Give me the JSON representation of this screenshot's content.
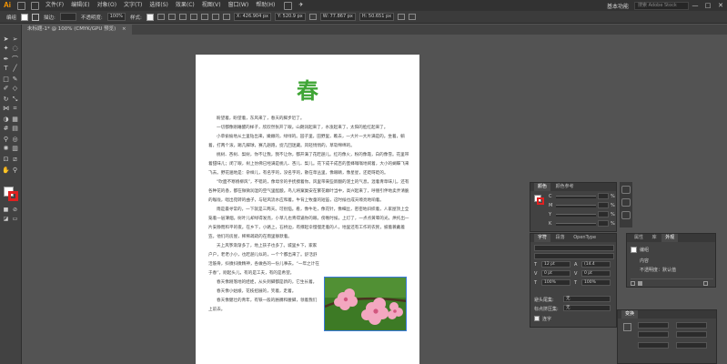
{
  "app": {
    "logo": "Ai",
    "menus": [
      "文件(F)",
      "编辑(E)",
      "对象(O)",
      "文字(T)",
      "选择(S)",
      "效果(C)",
      "视图(V)",
      "窗口(W)",
      "帮助(H)"
    ],
    "workspace": "基本功能",
    "search_placeholder": "搜索 Adobe Stock",
    "window_buttons": [
      "—",
      "□",
      "✕"
    ]
  },
  "control_bar": {
    "selection_label": "编组",
    "stroke_label": "描边:",
    "opacity_label": "不透明度:",
    "opacity_value": "100%",
    "style_label": "样式:",
    "x_value": "X: 426.904 px",
    "y_value": "Y: 520.9 px",
    "w_value": "W: 77.867 px",
    "h_value": "H: 50.651 px"
  },
  "document_tab": {
    "label": "未标题-1* @ 100% (CMYK/GPU 预览)",
    "close": "×"
  },
  "artboard": {
    "title": "春",
    "paragraphs": [
      "盼望着，盼望着，东风来了，春天的脚步近了。",
      "一切都像刚睡醒的样子，欣欣然张开了眼。山朗润起来了，水涨起来了，太阳的脸红起来了。",
      "小草偷偷地从土里钻出来，嫩嫩的，绿绿的。园子里，田野里，瞧去，一大片一大片满是的。坐着，躺着，打两个滚，踢几脚球，赛几趟跑，捉几回迷藏。风轻悄悄的，草软绵绵的。",
      "桃树、杏树、梨树，你不让我，我不让你，都开满了花赶趟儿。红的像火，粉的像霞，白的像雪。花里带着甜味儿；闭了眼，树上仿佛已经满是桃儿、杏儿、梨儿。花下成千成百的蜜蜂嗡嗡地闹着，大小的蝴蝶飞来飞去。野花遍地是：杂样儿，有名字的，没名字的，散在草丛里，像眼睛，像星星，还眨呀眨的。",
      "“吹面不寒杨柳风”，不错的，像母亲的手抚摸着你。风里带来些新翻的泥土的气息，混着青草味儿，还有各种花的香，都在微微润湿的空气里酝酿。鸟儿将窠巢安在繁花嫩叶当中，高兴起来了，呼朋引伴地卖弄清脆的喉咙，唱出宛转的曲子，与轻风流水应和着。牛背上牧童的短笛，这时候也成天嘹亮地响着。",
      "雨是最寻常的，一下就是三两天。可别恼。看，像牛毛，像花针，像细丝，密密地斜织着，人家屋顶上全笼着一层薄烟。树叶儿却绿得发亮，小草儿也青得逼你的眼。傍晚时候，上灯了，一点点黄晕的光，烘托出一片安静而和平的夜。在乡下，小路上，石桥边，有撑起伞慢慢走着的人，地里还有工作的农民，披着蓑戴着笠。他们的房屋，稀稀疏疏的在雨里静默着。",
      "天上风筝渐渐多了，地上孩子也多了。城里乡下，家家户户，老老小小，也赶趟儿似的，一个个都出来了。舒活舒活筋骨，抖擞抖擞精神，各做各的一份儿事去。“一年之计在于春”，刚起头儿，有的是工夫，有的是希望。",
      "春天像刚落地的娃娃，从头到脚都是新的，它生长着。",
      "春天像小姑娘，花枝招展的，笑着，走着。",
      "春天像健壮的青年，有铁一般的胳膊和腰脚，领着我们上前去。"
    ]
  },
  "color_panel": {
    "tabs": [
      "颜色",
      "颜色参考"
    ],
    "channels": [
      "C",
      "M",
      "Y",
      "K"
    ],
    "units": "%"
  },
  "character_panel": {
    "tabs": [
      "字符",
      "段落",
      "OpenType"
    ],
    "font_family": "",
    "size_value": "12 pt",
    "leading_value": "(14.4",
    "kerning_value": "0 pt",
    "tracking_value": "0 pt",
    "scale_value": "100%",
    "baseline_label": "避头尾集:",
    "baseline_value": "无",
    "mojikumi_label": "标点挤压集:",
    "mojikumi_value": "无",
    "hanging_label": "连字"
  },
  "appearance_panel": {
    "tabs": [
      "属性",
      "库",
      "外观"
    ],
    "item_label": "编组",
    "content_label": "内容",
    "opacity_label": "不透明度：默认值"
  },
  "transform_panel": {
    "title": "变换"
  }
}
